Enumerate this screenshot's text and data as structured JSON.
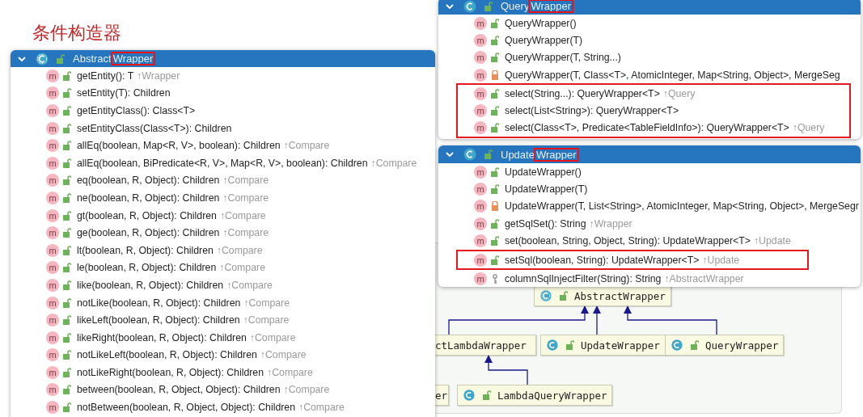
{
  "title": "条件构造器",
  "popups": [
    {
      "class_prefix": "Abstract",
      "class_highlight": "Wrapper",
      "kind": "abstract",
      "members": [
        {
          "icon": "m",
          "signature": "getEntity(): T",
          "origin": "↑Wrapper",
          "kind": "public",
          "boxed": false
        },
        {
          "icon": "m",
          "signature": "setEntity(T): Children",
          "kind": "public",
          "boxed": false
        },
        {
          "icon": "m",
          "signature": "getEntityClass(): Class<T>",
          "kind": "public",
          "boxed": false
        },
        {
          "icon": "m",
          "signature": "setEntityClass(Class<T>): Children",
          "kind": "public",
          "boxed": false
        },
        {
          "icon": "m",
          "signature": "allEq(boolean, Map<R, V>, boolean): Children",
          "origin": "↑Compare",
          "kind": "public",
          "boxed": false
        },
        {
          "icon": "m",
          "signature": "allEq(boolean, BiPredicate<R, V>, Map<R, V>, boolean): Children",
          "origin": "↑Compare",
          "kind": "public",
          "boxed": false
        },
        {
          "icon": "m",
          "signature": "eq(boolean, R, Object): Children",
          "origin": "↑Compare",
          "kind": "public",
          "boxed": false
        },
        {
          "icon": "m",
          "signature": "ne(boolean, R, Object): Children",
          "origin": "↑Compare",
          "kind": "public",
          "boxed": false
        },
        {
          "icon": "m",
          "signature": "gt(boolean, R, Object): Children",
          "origin": "↑Compare",
          "kind": "public",
          "boxed": false
        },
        {
          "icon": "m",
          "signature": "ge(boolean, R, Object): Children",
          "origin": "↑Compare",
          "kind": "public",
          "boxed": false
        },
        {
          "icon": "m",
          "signature": "lt(boolean, R, Object): Children",
          "origin": "↑Compare",
          "kind": "public",
          "boxed": false
        },
        {
          "icon": "m",
          "signature": "le(boolean, R, Object): Children",
          "origin": "↑Compare",
          "kind": "public",
          "boxed": false
        },
        {
          "icon": "m",
          "signature": "like(boolean, R, Object): Children",
          "origin": "↑Compare",
          "kind": "public",
          "boxed": false
        },
        {
          "icon": "m",
          "signature": "notLike(boolean, R, Object): Children",
          "origin": "↑Compare",
          "kind": "public",
          "boxed": false
        },
        {
          "icon": "m",
          "signature": "likeLeft(boolean, R, Object): Children",
          "origin": "↑Compare",
          "kind": "public",
          "boxed": false
        },
        {
          "icon": "m",
          "signature": "likeRight(boolean, R, Object): Children",
          "origin": "↑Compare",
          "kind": "public",
          "boxed": false
        },
        {
          "icon": "m",
          "signature": "notLikeLeft(boolean, R, Object): Children",
          "origin": "↑Compare",
          "kind": "public",
          "boxed": false
        },
        {
          "icon": "m",
          "signature": "notLikeRight(boolean, R, Object): Children",
          "origin": "↑Compare",
          "kind": "public",
          "boxed": false
        },
        {
          "icon": "m",
          "signature": "between(boolean, R, Object, Object): Children",
          "origin": "↑Compare",
          "kind": "public",
          "boxed": false
        },
        {
          "icon": "m",
          "signature": "notBetween(boolean, R, Object, Object): Children",
          "origin": "↑Compare",
          "kind": "public",
          "boxed": false
        }
      ]
    },
    {
      "class_prefix": "Query",
      "class_highlight": "Wrapper",
      "kind": "class",
      "members": [
        {
          "icon": "m",
          "signature": "QueryWrapper()",
          "kind": "public",
          "boxed": false
        },
        {
          "icon": "m",
          "signature": "QueryWrapper(T)",
          "kind": "public",
          "boxed": false
        },
        {
          "icon": "m",
          "signature": "QueryWrapper(T, String...)",
          "kind": "public",
          "boxed": false
        },
        {
          "icon": "m",
          "signature": "QueryWrapper(T, Class<T>, AtomicInteger, Map<String, Object>, MergeSeg",
          "kind": "private",
          "boxed": false
        },
        {
          "icon": "m",
          "signature": "select(String...): QueryWrapper<T>",
          "origin": "↑Query",
          "kind": "public",
          "boxed": true
        },
        {
          "icon": "m",
          "signature": "select(List<String>): QueryWrapper<T>",
          "kind": "public",
          "boxed": true
        },
        {
          "icon": "m",
          "signature": "select(Class<T>, Predicate<TableFieldInfo>): QueryWrapper<T>",
          "origin": "↑Query",
          "kind": "public",
          "boxed": true
        }
      ]
    },
    {
      "class_prefix": "Update",
      "class_highlight": "Wrapper",
      "kind": "class",
      "members": [
        {
          "icon": "m",
          "signature": "UpdateWrapper()",
          "kind": "public",
          "boxed": false
        },
        {
          "icon": "m",
          "signature": "UpdateWrapper(T)",
          "kind": "public",
          "boxed": false
        },
        {
          "icon": "m",
          "signature": "UpdateWrapper(T, List<String>, AtomicInteger, Map<String, Object>, MergeSegr",
          "kind": "private",
          "boxed": false
        },
        {
          "icon": "m",
          "signature": "getSqlSet(): String",
          "origin": "↑Wrapper",
          "kind": "public",
          "boxed": false
        },
        {
          "icon": "m",
          "signature": "set(boolean, String, Object, String): UpdateWrapper<T>",
          "origin": "↑Update",
          "kind": "public",
          "boxed": false
        },
        {
          "icon": "m",
          "signature": "setSql(boolean, String): UpdateWrapper<T>",
          "origin": "↑Update",
          "kind": "public",
          "boxed": true
        },
        {
          "icon": "m",
          "signature": "columnSqlInjectFilter(String): String",
          "origin": "↑AbstractWrapper",
          "kind": "protected",
          "boxed": false
        }
      ]
    }
  ],
  "diagram": {
    "nodes": [
      {
        "label": "AbstractWrapper",
        "kind": "abstract"
      },
      {
        "label": "ctLambdaWrapper",
        "kind": "cut"
      },
      {
        "label": "UpdateWrapper",
        "kind": "class"
      },
      {
        "label": "QueryWrapper",
        "kind": "class"
      },
      {
        "label": "er",
        "kind": "cut"
      },
      {
        "label": "LambdaQueryWrapper",
        "kind": "class"
      }
    ]
  }
}
